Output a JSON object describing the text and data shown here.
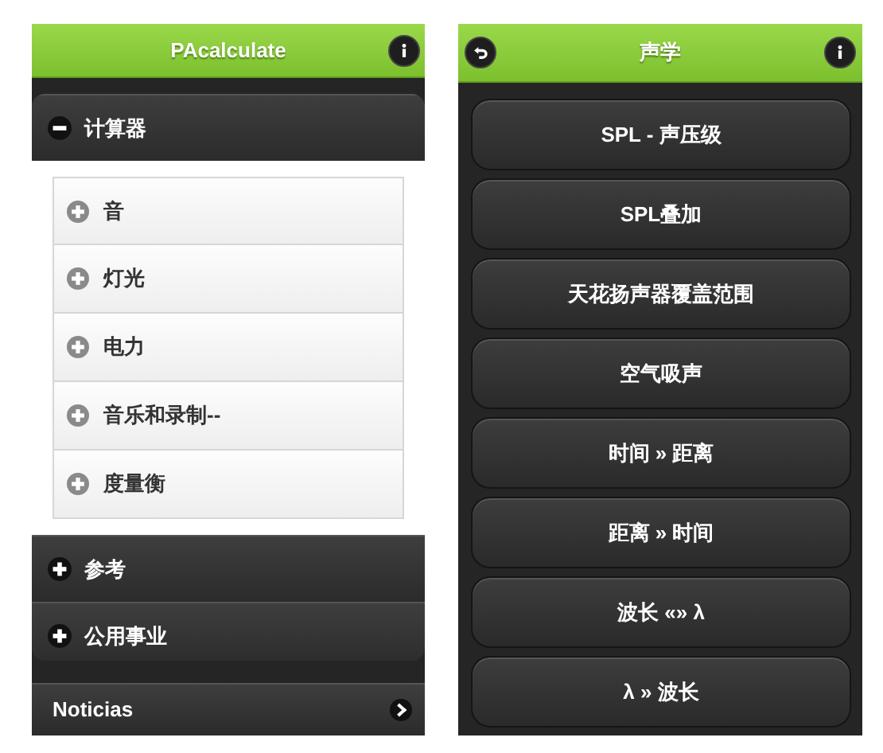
{
  "left_screen": {
    "header": {
      "title": "PAcalculate"
    },
    "sections": [
      {
        "label": "计算器",
        "expanded": true,
        "items": [
          {
            "label": "音"
          },
          {
            "label": "灯光"
          },
          {
            "label": "电力"
          },
          {
            "label": "音乐和录制--"
          },
          {
            "label": "度量衡"
          }
        ]
      },
      {
        "label": "参考",
        "expanded": false
      },
      {
        "label": "公用事业",
        "expanded": false
      }
    ],
    "footer_link": {
      "label": "Noticias"
    }
  },
  "right_screen": {
    "header": {
      "title": "声学"
    },
    "buttons": [
      "SPL - 声压级",
      "SPL叠加",
      "天花扬声器覆盖范围",
      "空气吸声",
      "时间 » 距离",
      "距离 » 时间",
      "波长 «» λ",
      "λ » 波长"
    ]
  }
}
